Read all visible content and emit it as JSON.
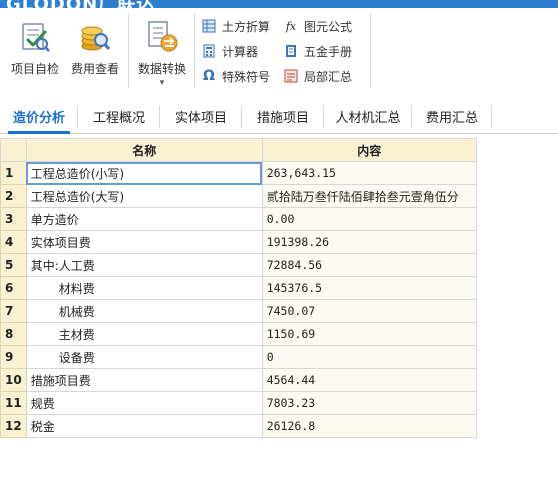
{
  "titlebar": {
    "app_name": "GLODON广联达"
  },
  "ribbon": {
    "big_buttons": [
      {
        "label": "项目自检",
        "icon": "project-check-icon"
      },
      {
        "label": "费用查看",
        "icon": "fee-view-icon"
      },
      {
        "label": "数据转换",
        "icon": "data-convert-icon",
        "dropdown": "▾"
      }
    ],
    "small_buttons": [
      {
        "label": "土方折算",
        "icon": "earthwork-icon",
        "glyph": "▦"
      },
      {
        "label": "计算器",
        "icon": "calculator-icon",
        "glyph": "▦"
      },
      {
        "label": "特殊符号",
        "icon": "omega-icon",
        "glyph": "Ω"
      },
      {
        "label": "图元公式",
        "icon": "formula-icon",
        "glyph": "fx"
      },
      {
        "label": "五金手册",
        "icon": "hardware-manual-icon",
        "glyph": "▮"
      },
      {
        "label": "局部汇总",
        "icon": "partial-summary-icon",
        "glyph": "▤"
      }
    ]
  },
  "tabs": [
    {
      "label": "造价分析",
      "active": true
    },
    {
      "label": "工程概况",
      "active": false
    },
    {
      "label": "实体项目",
      "active": false
    },
    {
      "label": "措施项目",
      "active": false
    },
    {
      "label": "人材机汇总",
      "active": false
    },
    {
      "label": "费用汇总",
      "active": false
    }
  ],
  "table": {
    "columns": [
      "名称",
      "内容"
    ],
    "rows": [
      {
        "num": "1",
        "name": "工程总造价(小写)",
        "value": "263,643.15",
        "indent": false
      },
      {
        "num": "2",
        "name": "工程总造价(大写)",
        "value": "贰拾陆万叁仟陆佰肆拾叁元壹角伍分",
        "indent": false,
        "cjk": true
      },
      {
        "num": "3",
        "name": "单方造价",
        "value": "0.00",
        "indent": false
      },
      {
        "num": "4",
        "name": "实体项目费",
        "value": "191398.26",
        "indent": false
      },
      {
        "num": "5",
        "name": "其中:人工费",
        "value": "72884.56",
        "indent": false
      },
      {
        "num": "6",
        "name": "材料费",
        "value": "145376.5",
        "indent": true
      },
      {
        "num": "7",
        "name": "机械费",
        "value": "7450.07",
        "indent": true
      },
      {
        "num": "8",
        "name": "主材费",
        "value": "1150.69",
        "indent": true
      },
      {
        "num": "9",
        "name": "设备费",
        "value": "0",
        "indent": true
      },
      {
        "num": "10",
        "name": "措施项目费",
        "value": "4564.44",
        "indent": false
      },
      {
        "num": "11",
        "name": "规费",
        "value": "7803.23",
        "indent": false
      },
      {
        "num": "12",
        "name": "税金",
        "value": "26126.8",
        "indent": false
      }
    ]
  },
  "colors": {
    "accent": "#1a6fce",
    "header_bg": "#faf0d2",
    "value_bg": "#fdfbf1"
  }
}
